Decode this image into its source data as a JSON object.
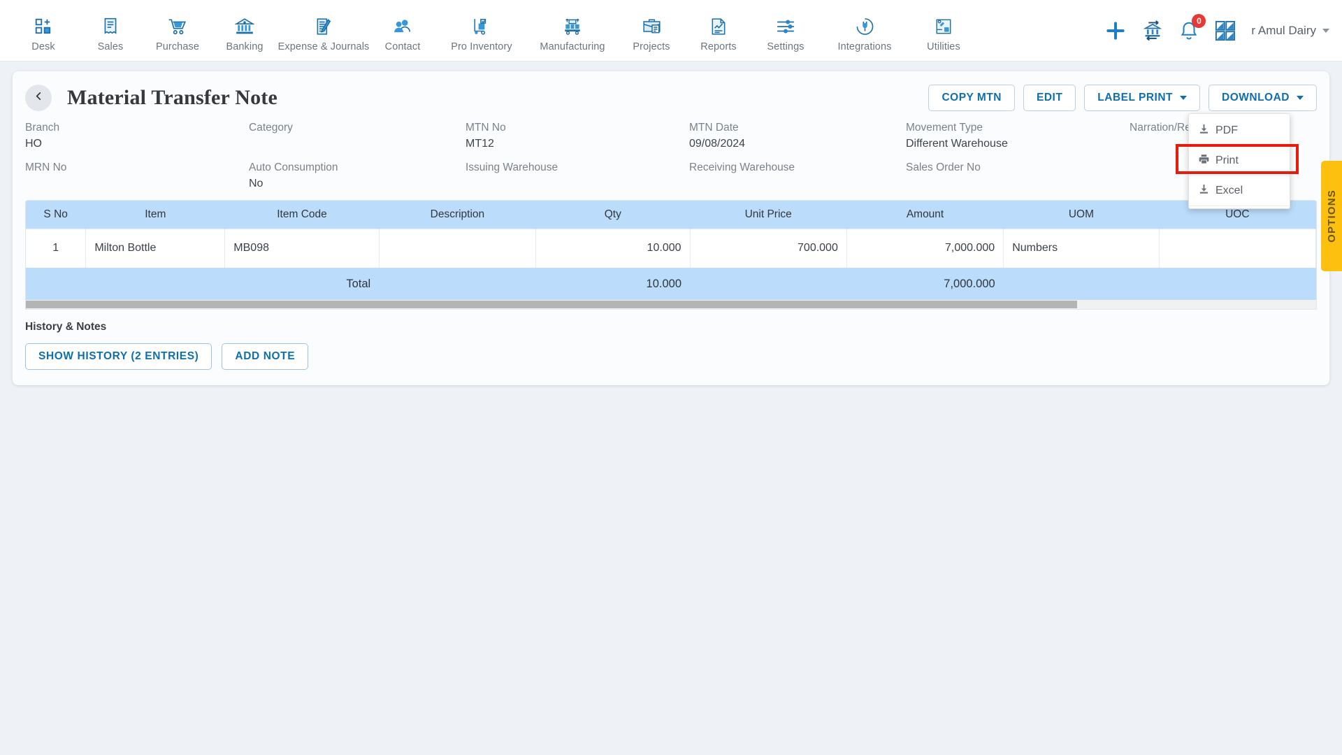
{
  "nav": {
    "items": [
      {
        "label": "Desk",
        "icon": "desk-grid-plus-icon"
      },
      {
        "label": "Sales",
        "icon": "receipt-icon"
      },
      {
        "label": "Purchase",
        "icon": "shopping-cart-icon"
      },
      {
        "label": "Banking",
        "icon": "bank-building-icon"
      },
      {
        "label": "Expense & Journals",
        "icon": "notebook-pen-icon"
      },
      {
        "label": "Contact",
        "icon": "people-icon"
      },
      {
        "label": "Pro Inventory",
        "icon": "hand-truck-icon"
      },
      {
        "label": "Manufacturing",
        "icon": "pallet-boxes-icon"
      },
      {
        "label": "Projects",
        "icon": "briefcase-icon"
      },
      {
        "label": "Reports",
        "icon": "report-chart-icon"
      },
      {
        "label": "Settings",
        "icon": "sliders-icon"
      },
      {
        "label": "Integrations",
        "icon": "plug-circle-icon"
      },
      {
        "label": "Utilities",
        "icon": "utilities-window-icon"
      }
    ],
    "right": {
      "add_icon": "plus-icon",
      "transfer_icon": "bank-transfer-icon",
      "notifications_icon": "bell-icon",
      "notification_count": "0",
      "apps_icon": "apps-grid-icon",
      "company_name": "r Amul Dairy",
      "company_caret_icon": "chevron-down-icon"
    }
  },
  "header": {
    "back_icon": "chevron-left-icon",
    "title": "Material Transfer Note",
    "buttons": {
      "copy": "COPY MTN",
      "edit": "EDIT",
      "label_print": "LABEL PRINT",
      "download": "DOWNLOAD"
    }
  },
  "download_menu": {
    "items": [
      {
        "label": "PDF",
        "icon": "download-icon",
        "highlighted": false
      },
      {
        "label": "Print",
        "icon": "printer-icon",
        "highlighted": true
      },
      {
        "label": "Excel",
        "icon": "download-icon",
        "highlighted": false
      }
    ],
    "highlight_color": "#e81c0e"
  },
  "details": {
    "row1": [
      {
        "label": "Branch",
        "value": "HO"
      },
      {
        "label": "Category",
        "value": ""
      },
      {
        "label": "MTN No",
        "value": "MT12"
      },
      {
        "label": "MTN Date",
        "value": "09/08/2024"
      },
      {
        "label": "Movement Type",
        "value": "Different Warehouse"
      },
      {
        "label": "Narration/Referen",
        "value": ""
      }
    ],
    "row2": [
      {
        "label": "MRN No",
        "value": ""
      },
      {
        "label": "Auto Consumption",
        "value": "No"
      },
      {
        "label": "Issuing Warehouse",
        "value": ""
      },
      {
        "label": "Receiving Warehouse",
        "value": ""
      },
      {
        "label": "Sales Order No",
        "value": ""
      },
      {
        "label": "",
        "value": ""
      }
    ]
  },
  "table": {
    "headers": [
      "S No",
      "Item",
      "Item Code",
      "Description",
      "Qty",
      "Unit Price",
      "Amount",
      "UOM",
      "UOC"
    ],
    "rows": [
      {
        "s_no": "1",
        "item": "Milton Bottle",
        "item_code": "MB098",
        "description": "",
        "qty": "10.000",
        "unit_price": "700.000",
        "amount": "7,000.000",
        "uom": "Numbers",
        "uoc": ""
      }
    ],
    "total": {
      "label": "Total",
      "qty": "10.000",
      "amount": "7,000.000"
    }
  },
  "history": {
    "title": "History & Notes",
    "show_history_label": "SHOW HISTORY (2 ENTRIES)",
    "add_note_label": "ADD NOTE"
  },
  "options_tab": {
    "label": "OPTIONS",
    "color": "#fdc00f"
  }
}
